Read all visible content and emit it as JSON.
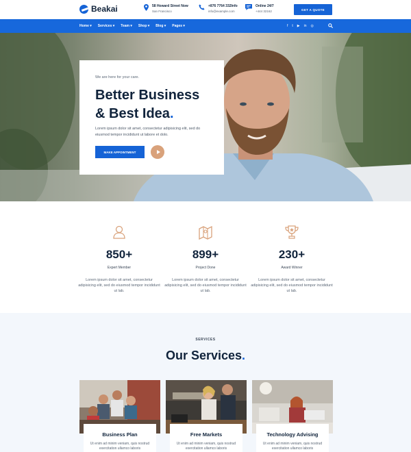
{
  "brand": {
    "name": "Beakai"
  },
  "header": {
    "address": {
      "line1": "58 Howard Street Now",
      "line2": "San Francisco"
    },
    "phone": {
      "line1": "+876 7764 332Info",
      "line2": "info@example.com"
    },
    "online": {
      "line1": "Online 24/7",
      "line2": "+444 32162"
    },
    "quote_button": "GET A QUOTE"
  },
  "nav": {
    "items": [
      "Home ▾",
      "Services ▾",
      "Team ▾",
      "Shop ▾",
      "Blog ▾",
      "Pages ▾"
    ],
    "socials": [
      "f",
      "t",
      "▶",
      "in",
      "◎"
    ]
  },
  "hero": {
    "kicker": "We are here for your care.",
    "title_line1": "Better Business",
    "title_line2": "& Best Idea",
    "title_dot": ".",
    "text": "Lorem ipsum dolor sit amet, consectetur adipisicing elit, sed do eiusmod tempor incididunt ut labore et dolo.",
    "button": "MAKE APPOINTMENT"
  },
  "stats": [
    {
      "icon": "user-icon",
      "number": "850+",
      "label": "Expert Member",
      "text": "Lorem ipsum dolor sit amet, consectetur adipisicing elit, sed do eiusmod tempor incididunt ut lab."
    },
    {
      "icon": "map-icon",
      "number": "899+",
      "label": "Project Done",
      "text": "Lorem ipsum dolor sit amet, consectetur adipisicing elit, sed do eiusmod tempor incididunt ut lab."
    },
    {
      "icon": "trophy-icon",
      "number": "230+",
      "label": "Award Winner",
      "text": "Lorem ipsum dolor sit amet, consectetur adipisicing elit, sed do eiusmod tempor incididunt ut lab."
    }
  ],
  "services": {
    "kicker": "SERVICES",
    "title": "Our Services",
    "title_dot": ".",
    "cards": [
      {
        "name": "Business Plan",
        "desc": "Ut enim ad minim veniam, quis nostrud exercitation ullamco laboris"
      },
      {
        "name": "Free Markets",
        "desc": "Ut enim ad minim veniam, quis nostrud exercitation ullamco laboris"
      },
      {
        "name": "Technology Advising",
        "desc": "Ut enim ad minim veniam, quis nostrud exercitation ullamco laboris"
      }
    ]
  },
  "colors": {
    "primary": "#1563d6",
    "nav": "#1768dc",
    "accent": "#d9a27b",
    "dark": "#10233b",
    "services_bg": "#f3f7fc"
  }
}
